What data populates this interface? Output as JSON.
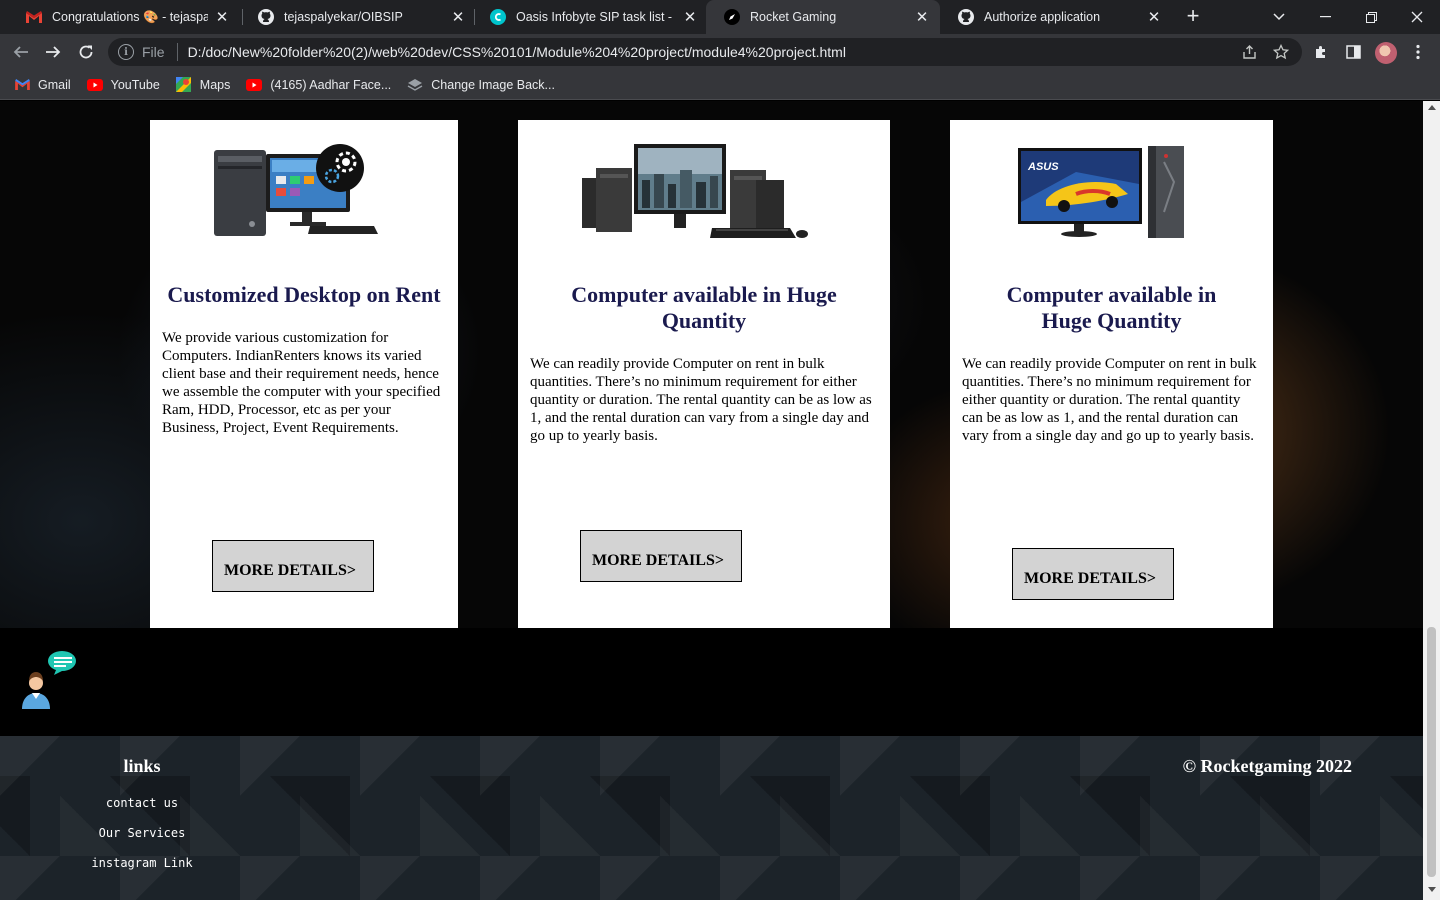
{
  "browser": {
    "tabs": [
      {
        "label": "Congratulations 🎨 - tejaspalye",
        "icon": "gmail-icon",
        "active": false
      },
      {
        "label": "tejaspalyekar/OIBSIP",
        "icon": "github-icon",
        "active": false
      },
      {
        "label": "Oasis Infobyte SIP task list - Pre",
        "icon": "canva-icon",
        "active": false
      },
      {
        "label": "Rocket Gaming",
        "icon": "rocket-icon",
        "active": true
      },
      {
        "label": "Authorize application",
        "icon": "github-icon",
        "active": false
      }
    ],
    "address": {
      "scheme": "File",
      "url": "D:/doc/New%20folder%20(2)/web%20dev/CSS%20101/Module%204%20project/module4%20project.html"
    },
    "bookmarks": [
      {
        "label": "Gmail",
        "icon": "gmail-icon"
      },
      {
        "label": "YouTube",
        "icon": "youtube-icon"
      },
      {
        "label": "Maps",
        "icon": "maps-icon"
      },
      {
        "label": "(4165) Aadhar Face...",
        "icon": "youtube-icon"
      },
      {
        "label": "Change Image Back...",
        "icon": "layers-icon"
      }
    ]
  },
  "cards": [
    {
      "title": "Customized Desktop on Rent",
      "text": "We provide various customization for Computers. IndianRenters knows its varied client base and their requirement needs, hence we assemble the computer with your specified Ram, HDD, Processor, etc as per your Business, Project, Event Requirements.",
      "button": "MORE DETAILS>",
      "image": "desktop-with-gear-icon"
    },
    {
      "title": "Computer available in Huge Quantity",
      "text": "We can readily provide Computer on rent in bulk quantities. There’s no minimum requirement for either quantity or duration. The rental quantity can be as low as 1, and the rental duration can vary from a single day and go up to yearly basis.",
      "button": "MORE DETAILS>",
      "image": "workstation-computers"
    },
    {
      "title": "Computer available in Huge Quantity",
      "text": "We can readily provide Computer on rent in bulk quantities. There’s no minimum requirement for either quantity or duration. The rental quantity can be as low as 1, and the rental duration can vary from a single day and go up to yearly basis.",
      "button": "MORE DETAILS>",
      "image": "asus-gaming-pc",
      "monitor_brand": "ASUS"
    }
  ],
  "footer": {
    "links_title": "links",
    "links": [
      "contact us",
      "Our Services",
      "instagram Link"
    ],
    "copyright": "© Rocketgaming 2022"
  },
  "colors": {
    "card_title": "#1a1a4e",
    "button_bg": "#d3d3d3",
    "chrome_dark": "#202124",
    "chrome_toolbar": "#35363a"
  }
}
